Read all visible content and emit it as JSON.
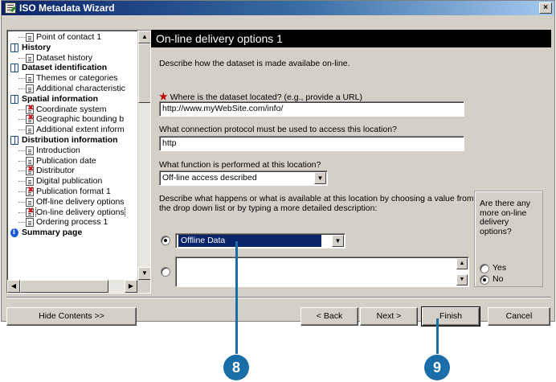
{
  "window": {
    "title": "ISO Metadata Wizard",
    "close_label": "×"
  },
  "tree": {
    "items": [
      {
        "label": "Point of contact 1",
        "level": 1,
        "icon": "page-icon"
      },
      {
        "label": "History",
        "level": 0,
        "icon": "book-icon"
      },
      {
        "label": "Dataset history",
        "level": 1,
        "icon": "page-icon"
      },
      {
        "label": "Dataset identification",
        "level": 0,
        "icon": "book-icon"
      },
      {
        "label": "Themes or categories",
        "level": 1,
        "icon": "page-icon"
      },
      {
        "label": "Additional characteristic",
        "level": 1,
        "icon": "page-icon"
      },
      {
        "label": "Spatial information",
        "level": 0,
        "icon": "book-icon"
      },
      {
        "label": "Coordinate system",
        "level": 1,
        "icon": "page-x-icon"
      },
      {
        "label": "Geographic bounding b",
        "level": 1,
        "icon": "page-x-icon"
      },
      {
        "label": "Additional extent inform",
        "level": 1,
        "icon": "page-icon"
      },
      {
        "label": "Distribution information",
        "level": 0,
        "icon": "book-icon"
      },
      {
        "label": "Introduction",
        "level": 1,
        "icon": "page-icon"
      },
      {
        "label": "Publication date",
        "level": 1,
        "icon": "page-icon"
      },
      {
        "label": "Distributor",
        "level": 1,
        "icon": "page-x-icon"
      },
      {
        "label": "Digital publication",
        "level": 1,
        "icon": "page-icon"
      },
      {
        "label": "Publication format 1",
        "level": 1,
        "icon": "page-x-icon"
      },
      {
        "label": "Off-line delivery options",
        "level": 1,
        "icon": "page-icon"
      },
      {
        "label": "On-line delivery options",
        "level": 1,
        "icon": "page-x-icon",
        "selected": true
      },
      {
        "label": "Ordering process 1",
        "level": 1,
        "icon": "page-icon"
      },
      {
        "label": "Summary page",
        "level": 0,
        "icon": "info-icon"
      }
    ]
  },
  "panel": {
    "title": "On-line delivery options 1",
    "intro": "Describe how the dataset is made availabe on-line.",
    "location_label": "Where is the dataset located? (e.g., provide a URL)",
    "location_value": "http://www.myWebSite.com/info/",
    "protocol_label": "What connection protocol must be used to access this location?",
    "protocol_value": "http",
    "function_label": "What function is performed at this location?",
    "function_value": "Off-line access described",
    "describe_line1": "Describe what happens or what is available at this location by choosing a value from",
    "describe_line2": "the drop down list or by typing a more detailed description:",
    "option_value": "Offline Data",
    "more_options_question": "Are there any more on-line delivery options?",
    "yes_label": "Yes",
    "no_label": "No"
  },
  "buttons": {
    "hide_contents": "Hide Contents >>",
    "back": "< Back",
    "next": "Next >",
    "finish": "Finish",
    "cancel": "Cancel"
  },
  "callouts": {
    "first": "8",
    "second": "9"
  },
  "colors": {
    "title_bar": "#0a246a",
    "header_bg": "#000000",
    "callout": "#1a6ea8",
    "required_star": "#c00000"
  }
}
